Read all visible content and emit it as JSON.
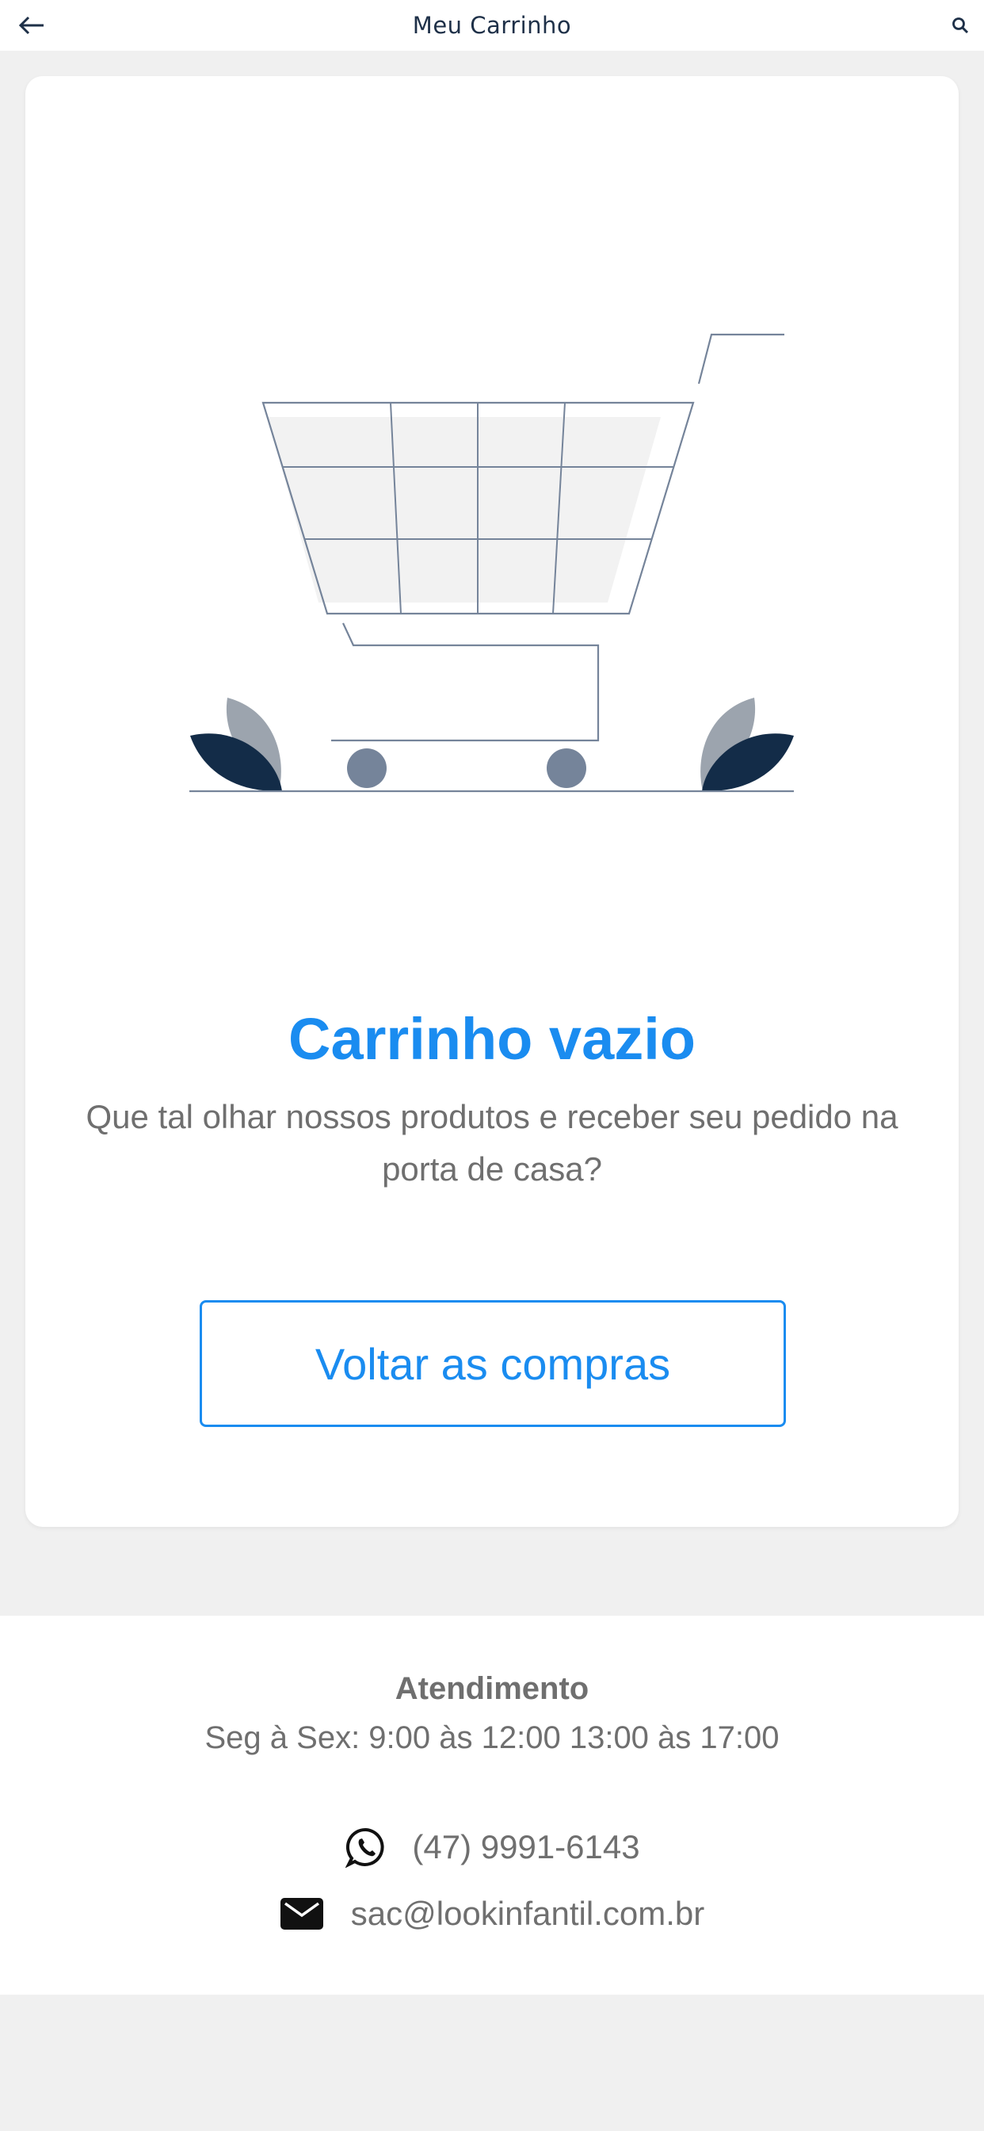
{
  "header": {
    "title": "Meu Carrinho",
    "back_icon": "arrow-left-icon",
    "search_icon": "search-icon"
  },
  "empty_cart": {
    "illustration_icon": "empty-shopping-cart-illustration",
    "title": "Carrinho vazio",
    "description": "Que tal olhar nossos produtos e receber seu pedido na porta de casa?",
    "button_label": "Voltar as compras"
  },
  "footer": {
    "title": "Atendimento",
    "hours": "Seg à Sex: 9:00 às 12:00 13:00 às 17:00",
    "phone": "(47) 9991-6143",
    "phone_icon": "whatsapp-icon",
    "email": "sac@lookinfantil.com.br",
    "email_icon": "mail-icon"
  },
  "colors": {
    "accent": "#1a8cf0",
    "header_text": "#1e3048",
    "body_text": "#6f6f6f",
    "background": "#f0f0f0",
    "leaf_dark": "#132c48",
    "leaf_light": "#9ca4ae",
    "cart_line": "#75849a"
  }
}
